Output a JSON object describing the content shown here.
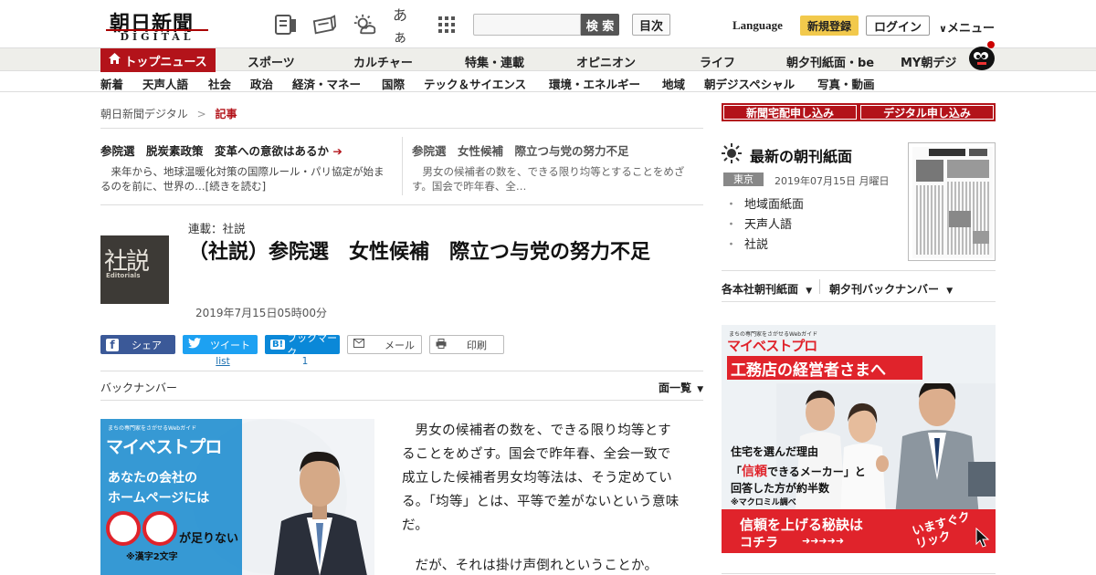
{
  "header": {
    "logo_main": "朝日新聞",
    "logo_sub": "DIGITAL",
    "icons": [
      "news-icon",
      "papers-icon",
      "weather-icon",
      "font-size-icon",
      "grid-icon"
    ],
    "font_size_label": "あぁ",
    "search_placeholder": "",
    "search_button": "検 索",
    "toc_button": "目次",
    "language": "Language",
    "register": "新規登録",
    "login": "ログイン",
    "menu": "メニュー"
  },
  "main_nav": {
    "top": "トップニュース",
    "items": [
      "スポーツ",
      "カルチャー",
      "特集・連載",
      "オピニオン",
      "ライフ",
      "朝夕刊紙面・be",
      "MY朝デジ"
    ]
  },
  "sub_nav": {
    "items": [
      "新着",
      "天声人語",
      "社会",
      "政治",
      "経済・マネー",
      "国際",
      "テック＆サイエンス",
      "環境・エネルギー",
      "地域",
      "朝デジスペシャル",
      "写真・動画"
    ]
  },
  "breadcrumb": {
    "home": "朝日新聞デジタル",
    "sep": ">",
    "current": "記事"
  },
  "related": [
    {
      "title": "参院選　脱炭素政策　変革への意欲はあるか",
      "desc": "　来年から、地球温暖化対策の国際ルール・パリ協定が始まるのを前に、世界の…[続きを読む]"
    },
    {
      "title": "参院選　女性候補　際立つ与党の努力不足",
      "desc": "　男女の候補者の数を、できる限り均等とすることをめざす。国会で昨年春、全…"
    }
  ],
  "article": {
    "series": "連載：社説",
    "thumb_big": "社説",
    "thumb_small": "Editorials",
    "headline": "（社説）参院選　女性候補　際立つ与党の努力不足",
    "date": "2019年7月15日05時00分",
    "share": {
      "facebook": "シェア",
      "twitter": "ツイート",
      "hatena": "ブックマーク",
      "hatena_mark": "B!",
      "mail": "メール",
      "print": "印刷",
      "twitter_count": "list",
      "hatena_count": "1"
    },
    "back_number": "バックナンバー",
    "list_label": "面一覧",
    "paragraphs": [
      "男女の候補者の数を、できる限り均等とすることをめざす。国会で昨年春、全会一致で成立した候補者男女均等法は、そう定めている。「均等」とは、平等で差がないという意味だ。",
      "だが、それは掛け声倒れということか。"
    ]
  },
  "ad_left": {
    "tagline": "まちの専門家をさがせるWebガイド",
    "brand": "マイベストプロ",
    "line1": "あなたの会社の",
    "line2": "ホームページには",
    "missing": "が足りない",
    "note": "※漢字2文字"
  },
  "sidebar": {
    "btn_home": "新聞宅配申し込み",
    "btn_digital": "デジタル申し込み",
    "latest_title": "最新の朝刊紙面",
    "region": "東京",
    "paper_date": "2019年07月15日 月曜日",
    "paper_links": [
      "地域面紙面",
      "天声人語",
      "社説"
    ],
    "link_papers": "各本社朝刊紙面",
    "link_backnumber": "朝夕刊バックナンバー"
  },
  "ad_right": {
    "tagline": "まちの専門家をさがせるWebガイド",
    "brand": "マイベストプロ",
    "headline": "工務店の経営者さまへ",
    "text1": "住宅を選んだ理由",
    "text2_pre": "「",
    "text2_hl": "信頼",
    "text2_post": "できるメーカー」と",
    "text3": "回答した方が約半数",
    "note": "※マクロミル調べ",
    "cta1": "信頼を上げる秘訣は",
    "cta2": "コチラ",
    "arrows": "➜➜➜➜➜",
    "click": "いますぐクリック"
  },
  "colors": {
    "brand_red": "#b3131a",
    "register_yellow": "#f2c94c",
    "facebook": "#3b5998",
    "twitter": "#1da1f2",
    "hatena": "#0a88d8"
  }
}
